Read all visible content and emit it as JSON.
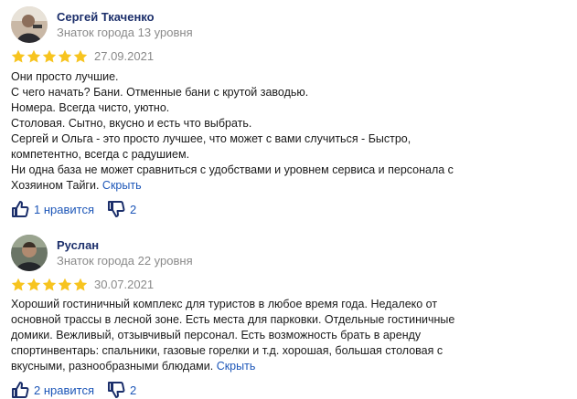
{
  "reviews": [
    {
      "author": "Сергей Ткаченко",
      "level": "Знаток города 13 уровня",
      "rating": 5,
      "date": "27.09.2021",
      "lines": [
        "Они просто лучшие.",
        "С чего начать? Бани. Отменные бани с крутой заводью.",
        "Номера. Всегда чисто, уютно.",
        "Столовая. Сытно, вкусно и есть что выбрать.",
        "Сергей и Ольга - это просто лучшее, что может с вами случиться - Быстро,",
        "компетентно, всегда с радушием.",
        "Ни одна база не может сравниться с удобствами и уровнем сервиса и персонала с",
        "Хозяином Тайги."
      ],
      "hide_label": "Скрыть",
      "likes_label": "1 нравится",
      "dislikes_count": "2"
    },
    {
      "author": "Руслан",
      "level": "Знаток города 22 уровня",
      "rating": 5,
      "date": "30.07.2021",
      "lines": [
        "Хороший гостиничный комплекс для туристов в любое время года. Недалеко от",
        "основной трассы в лесной зоне. Есть места для парковки. Отдельные гостиничные",
        "домики. Вежливый, отзывчивый персонал. Есть возможность брать в аренду",
        "спортинвентарь: спальники, газовые горелки и т.д. хорошая, большая столовая с",
        "вкусными, разнообразными блюдами."
      ],
      "hide_label": "Скрыть",
      "likes_label": "2 нравится",
      "dislikes_count": "2"
    }
  ],
  "colors": {
    "star": "#f7c41f",
    "link": "#1c56b8",
    "name": "#1c2f6b",
    "meta": "#8a8a8a"
  },
  "icons": {
    "like": "thumbs-up-icon",
    "dislike": "thumbs-down-icon",
    "star": "star-icon"
  }
}
